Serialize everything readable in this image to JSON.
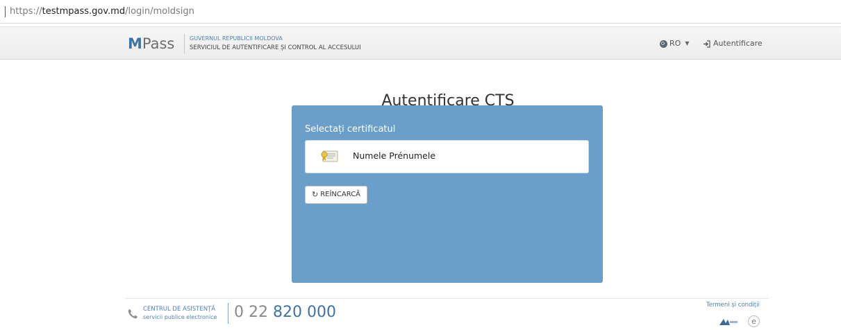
{
  "browser": {
    "url_scheme": "https://",
    "url_host": "testmpass.gov.md",
    "url_path": "/login/moldsign"
  },
  "header": {
    "logo_m": "M",
    "logo_rest": "Pass",
    "org_line1": "GUVERNUL REPUBLICII MOLDOVA",
    "org_line2": "SERVICIUL DE AUTENTIFICARE ȘI CONTROL AL ACCESULUI",
    "language": "RO",
    "login_label": "Autentificare",
    "icons": [
      "globe-icon",
      "chevron-down-icon",
      "sign-in-icon"
    ]
  },
  "main": {
    "title": "Autentificare CTS",
    "panel_heading": "Selectați certificatul",
    "certificates": [
      {
        "name": "Numele Prénumele",
        "icon": "certificate-icon"
      }
    ],
    "reload_label": "REÎNCARCĂ"
  },
  "footer": {
    "help_line1": "CENTRUL DE ASISTENȚĂ",
    "help_line2": "servicii publice electronice",
    "phone_prefix": "0 22",
    "phone_main": "820 000",
    "terms_label": "Termeni și condiții"
  },
  "colors": {
    "brand_blue": "#3f73a4",
    "panel_blue": "#6b9fc9",
    "header_bg": "#efefef"
  }
}
